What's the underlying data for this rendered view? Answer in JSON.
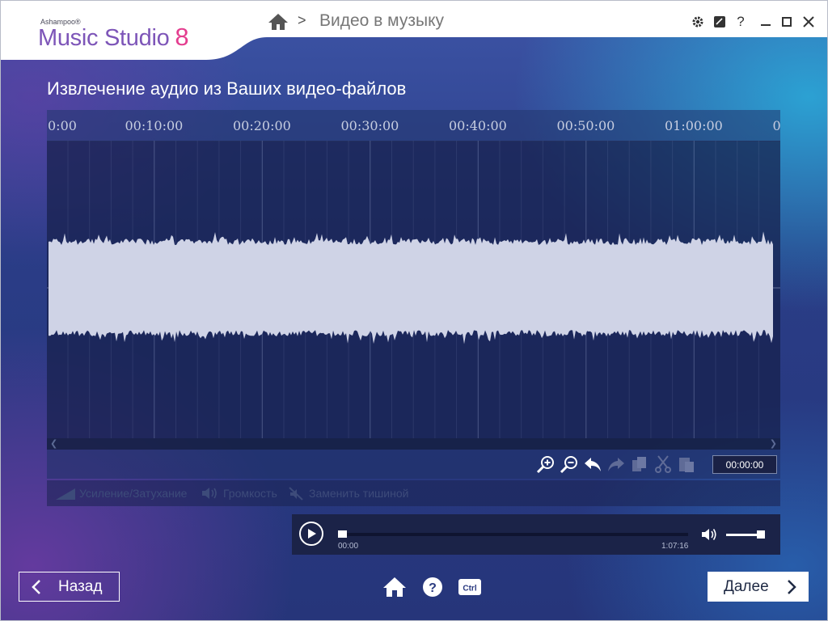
{
  "app": {
    "brand_small": "Ashampoo®",
    "brand_name": "Music Studio",
    "brand_version": "8"
  },
  "breadcrumb": {
    "home_icon": "home-icon",
    "separator": ">",
    "title": "Видео в музыку"
  },
  "window_controls": [
    "gear-icon",
    "note-icon",
    "help-icon",
    "minimize-icon",
    "maximize-icon",
    "close-icon"
  ],
  "page": {
    "title": "Извлечение аудио из Ваших видео-файлов"
  },
  "timeline": {
    "ticks": [
      "0:00",
      "00:10:00",
      "00:20:00",
      "00:30:00",
      "00:40:00",
      "00:50:00",
      "01:00:00",
      "0"
    ]
  },
  "toolbar": {
    "tools": [
      {
        "name": "zoom-in-icon",
        "enabled": true
      },
      {
        "name": "zoom-out-icon",
        "enabled": true
      },
      {
        "name": "undo-icon",
        "enabled": true
      },
      {
        "name": "redo-icon",
        "enabled": false
      },
      {
        "name": "copy-icon",
        "enabled": false
      },
      {
        "name": "cut-icon",
        "enabled": false
      },
      {
        "name": "paste-icon",
        "enabled": false
      }
    ],
    "time_value": "00:00:00"
  },
  "effects": {
    "fade_label": "Усиление/Затухание",
    "volume_label": "Громкость",
    "silence_label": "Заменить тишиной"
  },
  "player": {
    "current_time": "00:00",
    "total_time": "1:07:16",
    "progress_percent": 0,
    "volume_percent": 90
  },
  "footer": {
    "back_label": "Назад",
    "next_label": "Далее",
    "icons": [
      "home-icon",
      "help-icon",
      "keyboard-shortcuts-icon"
    ],
    "ctrl_label": "Ctrl"
  },
  "colors": {
    "brand_purple": "#7d55b8",
    "brand_pink": "#e43d8f",
    "waveform": "#cfd3e6"
  }
}
